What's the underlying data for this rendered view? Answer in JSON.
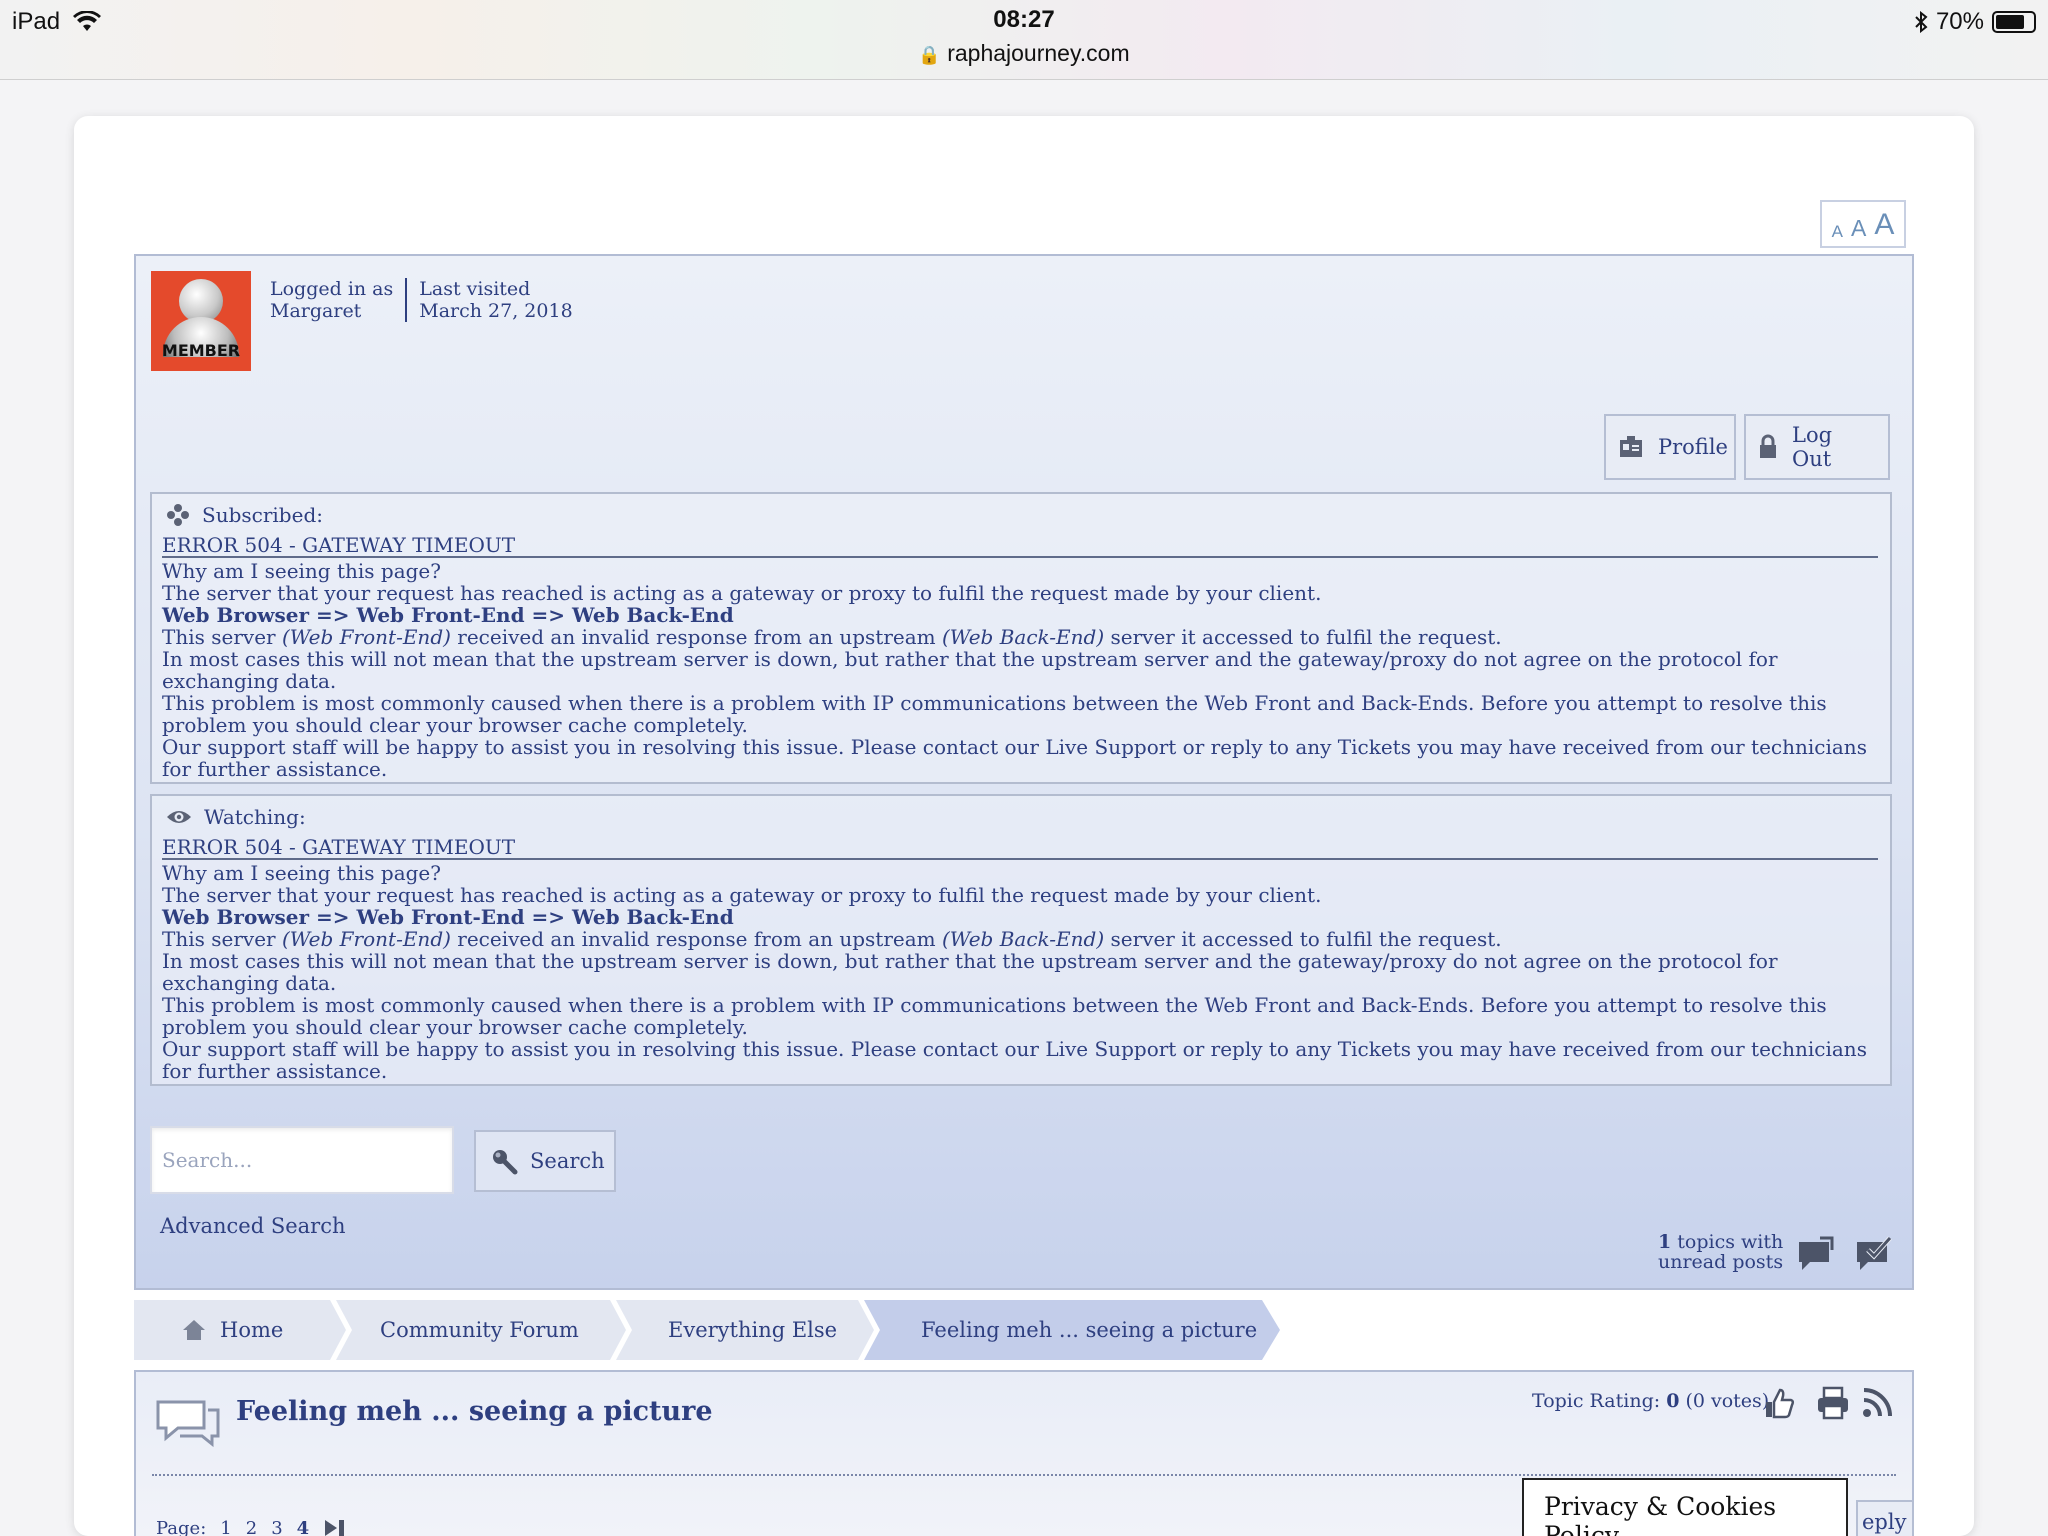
{
  "status_bar": {
    "device": "iPad",
    "time": "08:27",
    "url": "raphajourney.com",
    "battery": "70%"
  },
  "font_size_control": {
    "small": "A",
    "medium": "A",
    "large": "A"
  },
  "user": {
    "avatar_label": "MEMBER",
    "logged_in_label": "Logged in as",
    "username": "Margaret",
    "last_visited_label": "Last visited",
    "last_visited_date": "March 27, 2018"
  },
  "actions": {
    "profile": "Profile",
    "logout": "Log Out"
  },
  "notices": [
    {
      "label": "Subscribed:",
      "title": "ERROR 504 - GATEWAY TIMEOUT",
      "question": "Why am I seeing this page?",
      "line1": "The server that your request has reached is acting as a gateway or proxy to fulfil the request made by your client.",
      "flow_a": "Web Browser",
      "flow_sep1": " => ",
      "flow_b": "Web Front-End",
      "flow_sep2": " => ",
      "flow_c": "Web Back-End",
      "line3_a": "This server ",
      "line3_b": "(Web Front-End)",
      "line3_c": " received an invalid response from an upstream ",
      "line3_d": "(Web Back-End)",
      "line3_e": " server it accessed to fulfil the request.",
      "line4": "In most cases this will not mean that the upstream server is down, but rather that the upstream server and the gateway/proxy do not agree on the protocol for exchanging data.",
      "line5": "This problem is most commonly caused when there is a problem with IP communications between the Web Front and Back-Ends. Before you attempt to resolve this problem you should clear your browser cache completely.",
      "line6": "Our support staff will be happy to assist you in resolving this issue. Please contact our Live Support or reply to any Tickets you may have received from our technicians for further assistance."
    },
    {
      "label": "Watching:",
      "title": "ERROR 504 - GATEWAY TIMEOUT",
      "question": "Why am I seeing this page?",
      "line1": "The server that your request has reached is acting as a gateway or proxy to fulfil the request made by your client.",
      "flow_a": "Web Browser",
      "flow_sep1": " => ",
      "flow_b": "Web Front-End",
      "flow_sep2": " => ",
      "flow_c": "Web Back-End",
      "line3_a": "This server ",
      "line3_b": "(Web Front-End)",
      "line3_c": " received an invalid response from an upstream ",
      "line3_d": "(Web Back-End)",
      "line3_e": " server it accessed to fulfil the request.",
      "line4": "In most cases this will not mean that the upstream server is down, but rather that the upstream server and the gateway/proxy do not agree on the protocol for exchanging data.",
      "line5": "This problem is most commonly caused when there is a problem with IP communications between the Web Front and Back-Ends. Before you attempt to resolve this problem you should clear your browser cache completely.",
      "line6": "Our support staff will be happy to assist you in resolving this issue. Please contact our Live Support or reply to any Tickets you may have received from our technicians for further assistance."
    }
  ],
  "search": {
    "placeholder": "Search...",
    "button": "Search",
    "advanced": "Advanced Search"
  },
  "unread": {
    "count": "1",
    "text_a": " topics with",
    "text_b": "unread posts"
  },
  "breadcrumb": [
    "Home",
    "Community Forum",
    "Everything Else",
    "Feeling meh ... seeing a picture"
  ],
  "topic": {
    "title": "Feeling meh ... seeing a picture",
    "rating_label": "Topic Rating: ",
    "rating_value": "0",
    "rating_votes": " (0 votes)",
    "page_label": "Page:",
    "pages": [
      "1",
      "2",
      "3",
      "4"
    ],
    "reply_fragment": "eply"
  },
  "privacy_banner": "Privacy & Cookies Policy",
  "colors": {
    "text": "#2e3f80",
    "panel_top": "#ecf0f8",
    "panel_bottom": "#c7d2ec",
    "crumb_active": "#c3cdea",
    "crumb": "#e3e7f1"
  }
}
